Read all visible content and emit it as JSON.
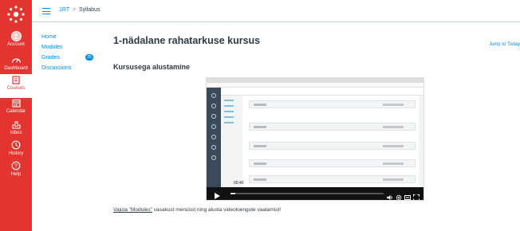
{
  "global_nav": {
    "items": [
      {
        "label": "Account",
        "icon": "account-icon"
      },
      {
        "label": "Dashboard",
        "icon": "dashboard-icon"
      },
      {
        "label": "Courses",
        "icon": "courses-icon",
        "active": true
      },
      {
        "label": "Calendar",
        "icon": "calendar-icon"
      },
      {
        "label": "Inbox",
        "icon": "inbox-icon"
      },
      {
        "label": "History",
        "icon": "history-icon"
      },
      {
        "label": "Help",
        "icon": "help-icon"
      }
    ],
    "brand_color": "#e3342f"
  },
  "breadcrumb": {
    "course": "1RT",
    "separator": ">",
    "current": "Syllabus"
  },
  "course_nav": {
    "items": [
      {
        "label": "Home"
      },
      {
        "label": "Modules"
      },
      {
        "label": "Grades",
        "badge": "25"
      },
      {
        "label": "Discussions"
      }
    ]
  },
  "main": {
    "title": "1-nädalane rahatarkuse kursus",
    "jump_link": "Jump to Today",
    "subtitle": "Kursusega alustamine",
    "footnote_link": "Vajuta \"Modules\"",
    "footnote_rest": " vasakust menüüst ning alusta videoloengute vaatamist!"
  },
  "video": {
    "time": "00:40",
    "progress": 0.03
  }
}
